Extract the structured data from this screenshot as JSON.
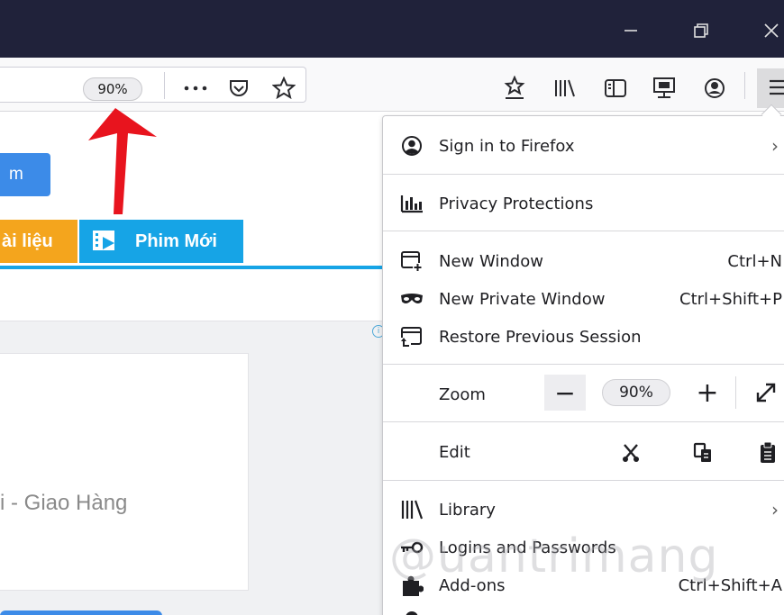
{
  "window": {
    "controls": {
      "minimize_icon": "minimize-icon",
      "restore_icon": "restore-icon",
      "close_icon": "close-icon"
    }
  },
  "toolbar": {
    "zoom_badge": "90%",
    "icons": [
      "page-actions-icon",
      "pocket-icon",
      "bookmark-star-icon",
      "bookmarks-menu-icon",
      "library-icon",
      "sidebar-icon",
      "screenshot-icon",
      "account-icon",
      "hamburger-menu-icon"
    ]
  },
  "page": {
    "blue_button_text": "m",
    "tab_orange": "ài liệu",
    "tab_cyan": "Phim Mới",
    "card_text": "i - Giao Hàng"
  },
  "menu": {
    "sign_in": {
      "label": "Sign in to Firefox",
      "chevron": "›"
    },
    "privacy": {
      "label": "Privacy Protections"
    },
    "new_window": {
      "label": "New Window",
      "shortcut": "Ctrl+N"
    },
    "private_window": {
      "label": "New Private Window",
      "shortcut": "Ctrl+Shift+P"
    },
    "restore": {
      "label": "Restore Previous Session"
    },
    "zoom": {
      "label": "Zoom",
      "minus": "−",
      "value": "90%",
      "plus": "+"
    },
    "edit": {
      "label": "Edit"
    },
    "library": {
      "label": "Library",
      "chevron": "›"
    },
    "logins": {
      "label": "Logins and Passwords"
    },
    "addons": {
      "label": "Add-ons",
      "shortcut": "Ctrl+Shift+A"
    }
  },
  "watermark": "@uantrimang",
  "colors": {
    "titlebar": "#20223a",
    "accent_blue": "#16a4e6",
    "annotation_red": "#e8141e",
    "orange": "#f4a51d"
  }
}
